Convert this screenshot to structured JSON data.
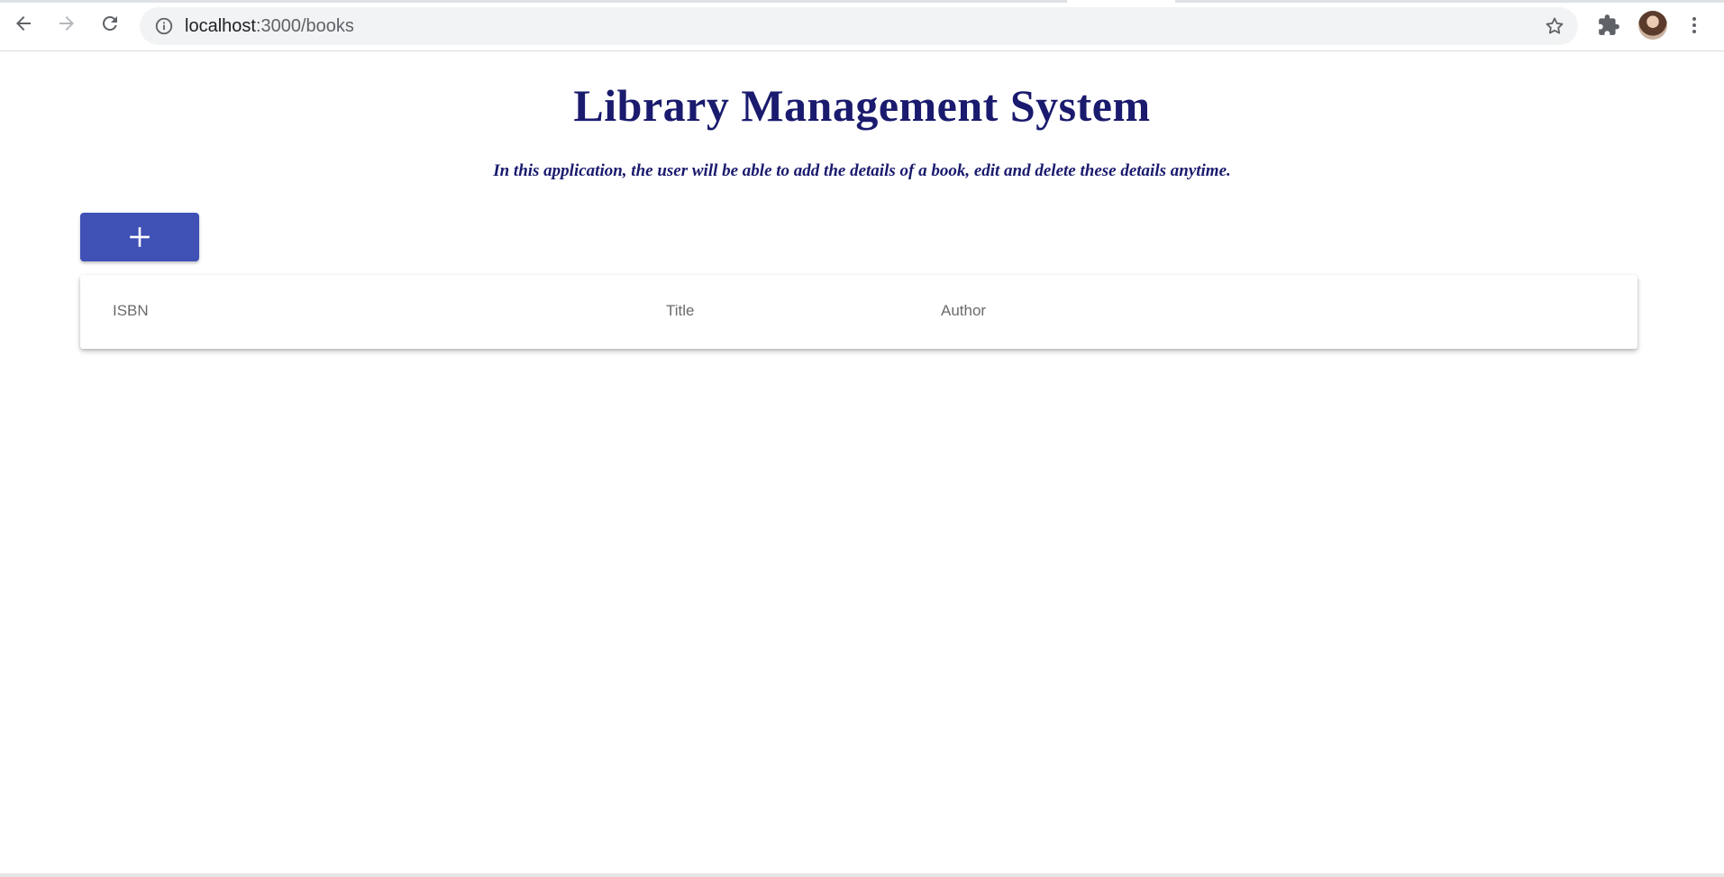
{
  "browser": {
    "url_host": "localhost",
    "url_path": ":3000/books"
  },
  "page": {
    "title": "Library Management System",
    "subtitle": "In this application, the user will be able to add the details of a book, edit and delete these details anytime."
  },
  "toolbar": {
    "add_icon": "plus-icon"
  },
  "table": {
    "columns": [
      "ISBN",
      "Title",
      "Author"
    ],
    "rows": []
  },
  "colors": {
    "title": "#1a1a6e",
    "accent": "#3f51b5"
  }
}
